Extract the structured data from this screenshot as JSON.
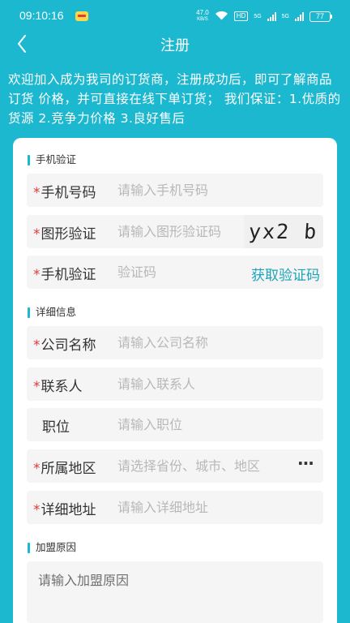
{
  "status_bar": {
    "time": "09:10:16",
    "speed_value": "47.0",
    "speed_unit": "KB/S",
    "hd": "HD",
    "net1": "5G",
    "net2": "5G",
    "battery": "77"
  },
  "nav": {
    "title": "注册"
  },
  "intro": "欢迎加入成为我司的订货商，注册成功后，即可了解商品订货 价格，并可直接在线下单订货； 我们保证：1.优质的货源 2.竞争力价格 3.良好售后",
  "sections": {
    "phone_verify": "手机验证",
    "details": "详细信息",
    "reason": "加盟原因"
  },
  "required_mark": "*",
  "fields": {
    "phone": {
      "label": "手机号码",
      "placeholder": "请输入手机号码"
    },
    "captcha": {
      "label": "图形验证",
      "placeholder": "请输入图形验证码",
      "image_text": "yx2 b"
    },
    "sms_code": {
      "label": "手机验证",
      "placeholder": "验证码",
      "action": "获取验证码"
    },
    "company": {
      "label": "公司名称",
      "placeholder": "请输入公司名称"
    },
    "contact": {
      "label": "联系人",
      "placeholder": "请输入联系人"
    },
    "position": {
      "label": "职位",
      "placeholder": "请输入职位"
    },
    "region": {
      "label": "所属地区",
      "placeholder": "请选择省份、城市、地区"
    },
    "address": {
      "label": "详细地址",
      "placeholder": "请输入详细地址"
    },
    "reason": {
      "placeholder": "请输入加盟原因"
    }
  },
  "colors": {
    "brand": "#1cb8cf",
    "required": "#e53935",
    "link": "#1ba4b9"
  }
}
